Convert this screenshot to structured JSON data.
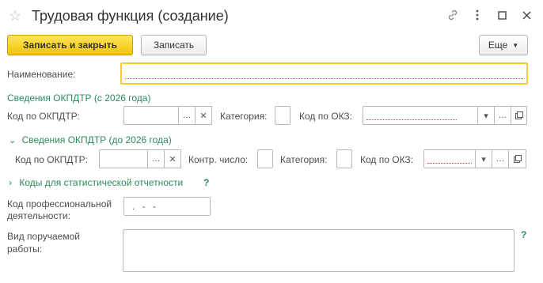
{
  "window": {
    "title": "Трудовая функция (создание)"
  },
  "toolbar": {
    "save_close_label": "Записать и закрыть",
    "save_label": "Записать",
    "more_label": "Еще"
  },
  "form": {
    "name_label": "Наименование:",
    "name_value": "",
    "section_2026_label": "Сведения ОКПДТР (с 2026 года)",
    "okpdtr_code_label": "Код по ОКПДТР:",
    "category_label": "Категория:",
    "okz_code_label": "Код по ОКЗ:",
    "section_before_2026_label": "Сведения ОКПДТР (до 2026 года)",
    "okpdtr_code_label_2": "Код по ОКПДТР:",
    "control_number_label": "Контр. число:",
    "category_label_2": "Категория:",
    "okz_code_label_2": "Код по ОКЗ:",
    "stat_codes_label": "Коды для статистической отчетности",
    "stat_codes_help": "?",
    "prof_code_label_line1": "Код профессиональной",
    "prof_code_label_line2": "деятельности:",
    "prof_code_value": ". - -",
    "work_type_label_line1": "Вид поручаемой",
    "work_type_label_line2": "работы:",
    "work_type_help": "?"
  },
  "icons": {
    "star": "star-icon",
    "link": "link-icon",
    "menu": "more-vertical-icon",
    "maximize": "maximize-icon",
    "close": "close-icon"
  },
  "colors": {
    "primary_button": "#f3c400",
    "section_text": "#2a8c5a",
    "focus_border": "#f0cf2c"
  }
}
